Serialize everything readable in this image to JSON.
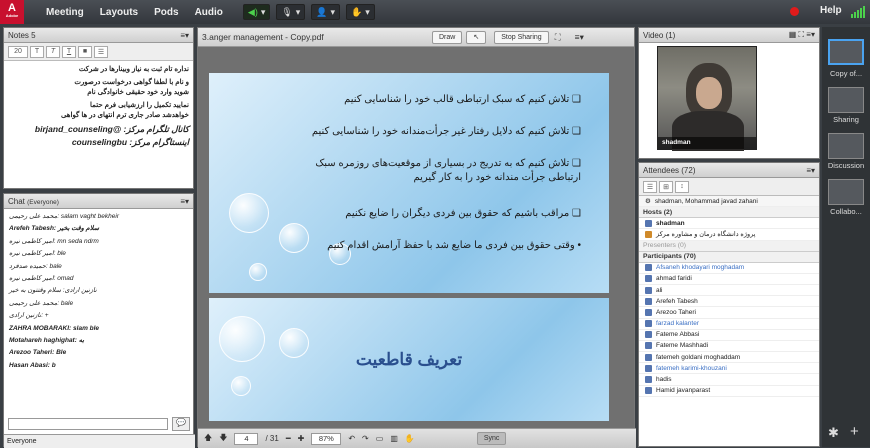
{
  "topbar": {
    "logo": "A",
    "logo_sub": "Adobe",
    "menu": [
      "Meeting",
      "Layouts",
      "Pods",
      "Audio"
    ],
    "help": "Help"
  },
  "notes": {
    "title": "Notes 5",
    "font_size": "20",
    "lines": [
      "نداره تام ثبت به نیاز وبینارها در شرکت",
      "و نام با لطفا گواهی درخواست درصورت",
      "شوید وارد خود حقیقی خانوادگی نام",
      "نمایید تکمیل را ارزشیابی فرم حتما",
      "خواهدشد صادر جاری ترم انتهای در ها گواهی"
    ],
    "links": [
      "کانال تلگرام مرکز: @birjand_counseling",
      "اینستاگرام مرکز: counselingbu"
    ]
  },
  "chat": {
    "title": "Chat",
    "scope": "(Everyone)",
    "messages": [
      "محمد علی رحیمی: salam vaght bekheir",
      "Arefeh Tabesh: سلام وقت بخیر",
      "امیر کاظمی نیره: mn seda ndrm",
      "امیر کاظمی نیره: ble",
      "حمیده صدفرد: bale",
      "امیر کاظمی نیره: omad",
      "نازنین ارادی: سلام وقتتون به خیر",
      "محمد علی رحیمی: bale",
      "نازنین ارادی: +",
      "ZAHRA MOBARAKI: slam ble",
      "Motahareh haghighat: به",
      "Arezoo Taheri: Ble",
      "Hasan Abasi: b"
    ],
    "footer": "Everyone"
  },
  "share": {
    "title": "3.anger management - Copy.pdf",
    "draw": "Draw",
    "stop": "Stop Sharing",
    "page": "4",
    "total": "/ 31",
    "zoom": "87%",
    "sync": "Sync"
  },
  "slide1": {
    "bullets": [
      "تلاش کنیم که سبک ارتباطی قالب خود را شناسایی کنیم",
      "تلاش کنیم که دلایل رفتار غیر جرأت‌مندانه خود را شناسایی کنیم",
      "تلاش کنیم که به تدریج در بسیاری از موقعیت‌های روزمره سبک ارتباطی جرأت مندانه خود را به کار گیریم",
      "مراقب باشیم که حقوق بین فردی دیگران را ضایع نکنیم",
      "وقتی حقوق بین فردی ما ضایع شد با حفظ آرامش اقدام کنیم"
    ]
  },
  "slide2": {
    "title": "تعریف قاطعیت"
  },
  "video": {
    "title": "Video",
    "count": "(1)",
    "name": "shadman"
  },
  "attendees": {
    "title": "Attendees",
    "count": "(72)",
    "me": "shadman, Mohammad javad zahani",
    "hosts_label": "Hosts (2)",
    "hosts": [
      "shadman",
      "پروژه دانشگاه درمان و مشاوره مرکز"
    ],
    "presenters_label": "Presenters (0)",
    "participants_label": "Participants (70)",
    "participants": [
      "Afsaneh khodayari moghadam",
      "ahmad faridi",
      "ali",
      "Arefeh Tabesh",
      "Arezoo Taheri",
      "farzad kalanter",
      "Fateme Abbasi",
      "Fateme Mashhadi",
      "fatemeh goldani moghaddam",
      "fatemeh karimi-khouzani",
      "hadis",
      "Hamid javanparast"
    ]
  },
  "right": {
    "items": [
      "Copy of...",
      "Sharing",
      "Discussion",
      "Collabo..."
    ]
  }
}
